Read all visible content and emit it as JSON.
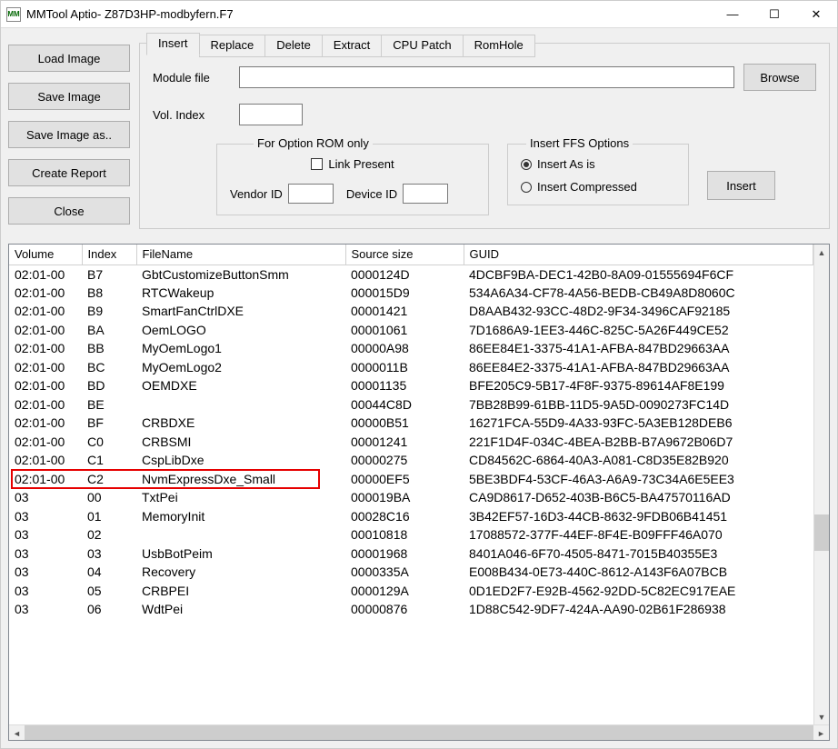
{
  "window": {
    "title": "MMTool Aptio- Z87D3HP-modbyfern.F7",
    "icon_text": "MM"
  },
  "left_buttons": {
    "load_image": "Load Image",
    "save_image": "Save Image",
    "save_image_as": "Save Image as..",
    "create_report": "Create Report",
    "close": "Close"
  },
  "tabs": {
    "insert": "Insert",
    "replace": "Replace",
    "delete": "Delete",
    "extract": "Extract",
    "cpu_patch": "CPU Patch",
    "rom_hole": "RomHole"
  },
  "form": {
    "module_file_label": "Module file",
    "module_file_value": "",
    "browse": "Browse",
    "vol_index_label": "Vol. Index",
    "vol_index_value": "",
    "option_rom_legend": "For Option ROM only",
    "link_present": "Link Present",
    "vendor_id_label": "Vendor ID",
    "vendor_id_value": "",
    "device_id_label": "Device ID",
    "device_id_value": "",
    "ffs_legend": "Insert FFS Options",
    "insert_as_is": "Insert As is",
    "insert_compressed": "Insert Compressed",
    "insert_btn": "Insert"
  },
  "table": {
    "headers": {
      "volume": "Volume",
      "index": "Index",
      "filename": "FileName",
      "source": "Source size",
      "guid": "GUID"
    },
    "rows": [
      {
        "volume": "02:01-00",
        "index": "B7",
        "filename": "GbtCustomizeButtonSmm",
        "source": "0000124D",
        "guid": "4DCBF9BA-DEC1-42B0-8A09-01555694F6CF"
      },
      {
        "volume": "02:01-00",
        "index": "B8",
        "filename": "RTCWakeup",
        "source": "000015D9",
        "guid": "534A6A34-CF78-4A56-BEDB-CB49A8D8060C"
      },
      {
        "volume": "02:01-00",
        "index": "B9",
        "filename": "SmartFanCtrlDXE",
        "source": "00001421",
        "guid": "D8AAB432-93CC-48D2-9F34-3496CAF92185"
      },
      {
        "volume": "02:01-00",
        "index": "BA",
        "filename": "OemLOGO",
        "source": "00001061",
        "guid": "7D1686A9-1EE3-446C-825C-5A26F449CE52"
      },
      {
        "volume": "02:01-00",
        "index": "BB",
        "filename": "MyOemLogo1",
        "source": "00000A98",
        "guid": "86EE84E1-3375-41A1-AFBA-847BD29663AA"
      },
      {
        "volume": "02:01-00",
        "index": "BC",
        "filename": "MyOemLogo2",
        "source": "0000011B",
        "guid": "86EE84E2-3375-41A1-AFBA-847BD29663AA"
      },
      {
        "volume": "02:01-00",
        "index": "BD",
        "filename": "OEMDXE",
        "source": "00001135",
        "guid": "BFE205C9-5B17-4F8F-9375-89614AF8E199"
      },
      {
        "volume": "02:01-00",
        "index": "BE",
        "filename": "",
        "source": "00044C8D",
        "guid": "7BB28B99-61BB-11D5-9A5D-0090273FC14D"
      },
      {
        "volume": "02:01-00",
        "index": "BF",
        "filename": "CRBDXE",
        "source": "00000B51",
        "guid": "16271FCA-55D9-4A33-93FC-5A3EB128DEB6"
      },
      {
        "volume": "02:01-00",
        "index": "C0",
        "filename": "CRBSMI",
        "source": "00001241",
        "guid": "221F1D4F-034C-4BEA-B2BB-B7A9672B06D7"
      },
      {
        "volume": "02:01-00",
        "index": "C1",
        "filename": "CspLibDxe",
        "source": "00000275",
        "guid": "CD84562C-6864-40A3-A081-C8D35E82B920"
      },
      {
        "volume": "02:01-00",
        "index": "C2",
        "filename": "NvmExpressDxe_Small",
        "source": "00000EF5",
        "guid": "5BE3BDF4-53CF-46A3-A6A9-73C34A6E5EE3",
        "highlight": true
      },
      {
        "volume": "03",
        "index": "00",
        "filename": "TxtPei",
        "source": "000019BA",
        "guid": "CA9D8617-D652-403B-B6C5-BA47570116AD"
      },
      {
        "volume": "03",
        "index": "01",
        "filename": "MemoryInit",
        "source": "00028C16",
        "guid": "3B42EF57-16D3-44CB-8632-9FDB06B41451"
      },
      {
        "volume": "03",
        "index": "02",
        "filename": "",
        "source": "00010818",
        "guid": "17088572-377F-44EF-8F4E-B09FFF46A070"
      },
      {
        "volume": "03",
        "index": "03",
        "filename": "UsbBotPeim",
        "source": "00001968",
        "guid": "8401A046-6F70-4505-8471-7015B40355E3"
      },
      {
        "volume": "03",
        "index": "04",
        "filename": "Recovery",
        "source": "0000335A",
        "guid": "E008B434-0E73-440C-8612-A143F6A07BCB"
      },
      {
        "volume": "03",
        "index": "05",
        "filename": "CRBPEI",
        "source": "0000129A",
        "guid": "0D1ED2F7-E92B-4562-92DD-5C82EC917EAE"
      },
      {
        "volume": "03",
        "index": "06",
        "filename": "WdtPei",
        "source": "00000876",
        "guid": "1D88C542-9DF7-424A-AA90-02B61F286938"
      }
    ]
  }
}
